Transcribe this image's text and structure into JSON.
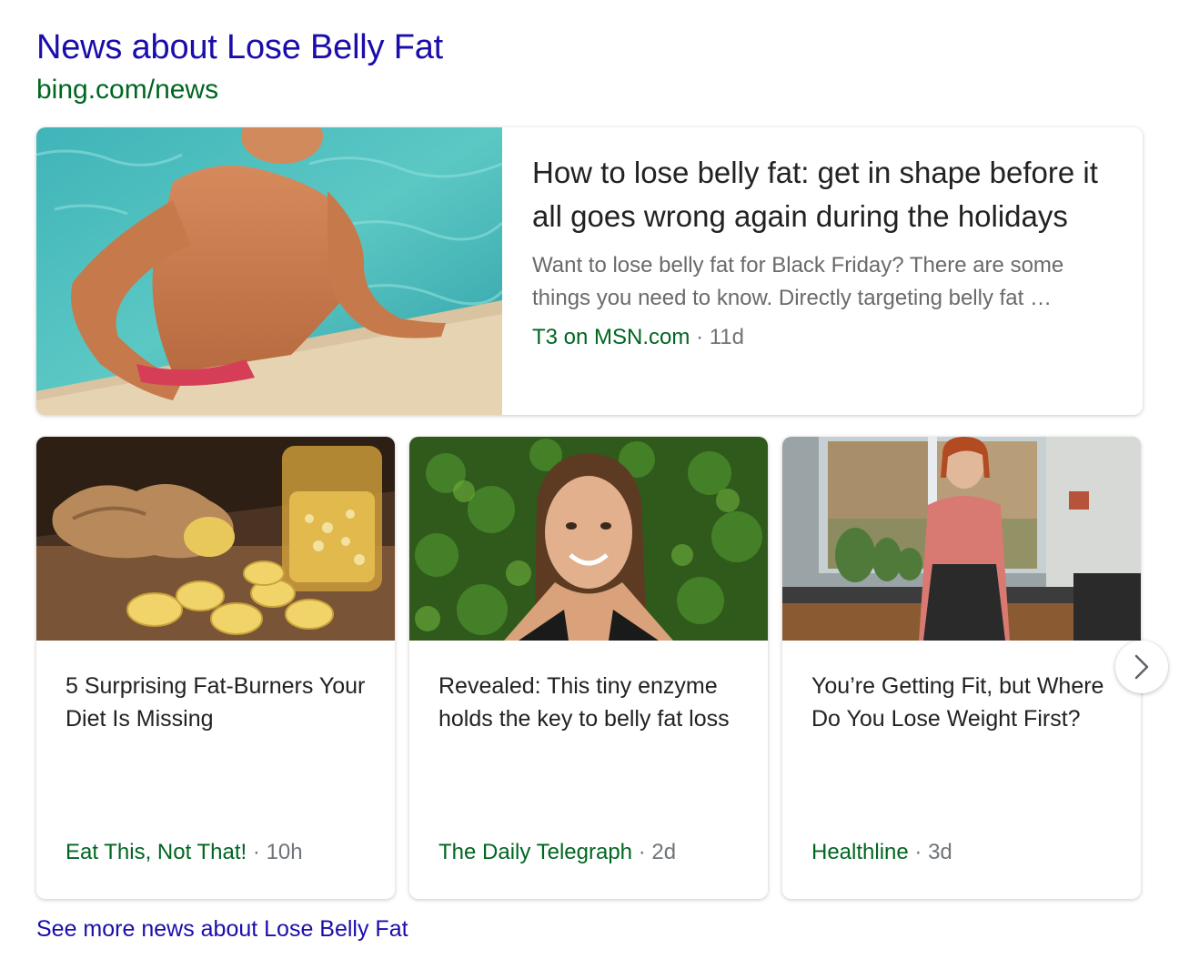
{
  "header": {
    "title": "News about Lose Belly Fat",
    "source": "bing.com/news"
  },
  "featured": {
    "title": "How to lose belly fat: get in shape before it all goes wrong again during the holidays",
    "snippet": "Want to lose belly fat for Black Friday? There are some things you need to know. Directly targeting belly fat …",
    "source": "T3 on MSN.com",
    "separator": "·",
    "age": "11d",
    "image": "man-in-pool-photo"
  },
  "cards": [
    {
      "title": "5 Surprising Fat-Burners Your Diet Is Missing",
      "source": "Eat This, Not That!",
      "separator": "·",
      "age": "10h",
      "image": "ginger-and-jar-photo"
    },
    {
      "title": "Revealed: This tiny enzyme holds the key to belly fat loss",
      "source": "The Daily Telegraph",
      "separator": "·",
      "age": "2d",
      "image": "woman-with-braids-photo"
    },
    {
      "title": "You’re Getting Fit, but Where Do You Lose Weight First?",
      "source": "Healthline",
      "separator": "·",
      "age": "3d",
      "image": "woman-in-kitchen-photo"
    }
  ],
  "carousel": {
    "next_icon": "chevron-right-icon"
  },
  "footer": {
    "see_more": "See more news about Lose Belly Fat"
  },
  "colors": {
    "link": "#1a0dab",
    "source_green": "#006621",
    "meta_gray": "#70757a"
  }
}
